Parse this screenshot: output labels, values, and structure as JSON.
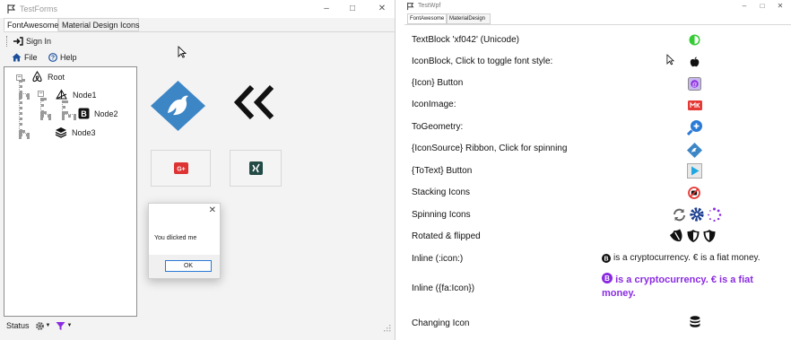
{
  "left_window": {
    "title": "TestForms",
    "tabs": [
      "FontAwesome",
      "Material Design Icons"
    ],
    "toolbar": {
      "sign_in": "Sign In",
      "file": "File",
      "help": "Help"
    },
    "tree": {
      "root": "Root",
      "node1": "Node1",
      "node2": "Node2",
      "node3": "Node3"
    },
    "status": "Status",
    "message_box": {
      "text": "You dlicked me",
      "ok": "OK"
    }
  },
  "right_window": {
    "title": "TestWpf",
    "tabs": [
      "FontAwesome",
      "MaterialDesign"
    ],
    "rows": [
      "TextBlock 'xf042' (Unicode)",
      "IconBlock, Click to toggle font style:",
      "{Icon} Button",
      "IconImage:",
      "ToGeometry:",
      "{IconSource} Ribbon, Click for spinning",
      "{ToText} Button",
      "Stacking Icons",
      "Spinning Icons",
      "Rotated & flipped",
      "Inline (:icon:)",
      "Inline ({fa:Icon})",
      "Changing Icon"
    ],
    "inline_plain": "is a cryptocurrency. € is a fiat money.",
    "inline_bold": "is a cryptocurrency. € is a fiat money."
  },
  "colors": {
    "accent_blue": "#2a7ad6",
    "mdi_tile_blue": "#3d86c6",
    "google_red": "#dd3333",
    "purple": "#8a2be2",
    "green": "#33cc33"
  },
  "icons": [
    "window-icon",
    "sign-in-icon",
    "home-icon",
    "help-icon",
    "airbnb-icon",
    "node-icon",
    "bold-icon",
    "layers-icon",
    "bird-icon",
    "double-chevron-left-icon",
    "google-plus-icon",
    "xing-icon",
    "filter-icon",
    "gear-icon",
    "apple-icon",
    "ribbon-icon",
    "play-icon",
    "database-icon"
  ]
}
